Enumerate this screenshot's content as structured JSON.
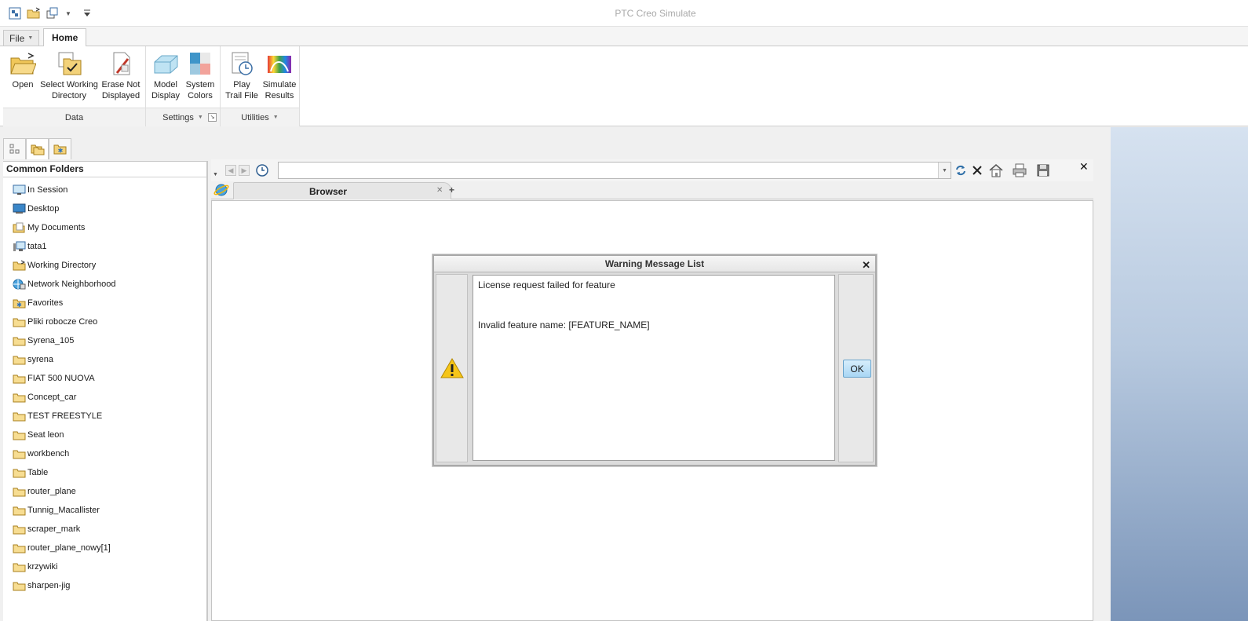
{
  "app": {
    "title": "PTC Creo Simulate",
    "quick_access": [
      "new-session-icon",
      "open-icon",
      "windows-icon",
      "customize-icon"
    ]
  },
  "ribbon": {
    "tabs": [
      {
        "label": "File",
        "active": false
      },
      {
        "label": "Home",
        "active": true
      }
    ],
    "groups": {
      "data": {
        "label": "Data",
        "buttons": [
          {
            "label": "Open",
            "icon": "open-folder-icon"
          },
          {
            "label": "Select Working Directory",
            "icon": "working-directory-icon"
          },
          {
            "label": "Erase Not Displayed",
            "icon": "erase-icon"
          }
        ]
      },
      "settings": {
        "label": "Settings",
        "buttons": [
          {
            "label": "Model Display",
            "icon": "model-display-icon"
          },
          {
            "label": "System Colors",
            "icon": "system-colors-icon"
          }
        ]
      },
      "utilities": {
        "label": "Utilities",
        "buttons": [
          {
            "label": "Play Trail File",
            "icon": "trail-file-icon"
          },
          {
            "label": "Simulate Results",
            "icon": "simulate-results-icon"
          }
        ]
      }
    },
    "labels": {
      "open_1": "Open",
      "swd_1": "Select Working",
      "swd_2": "Directory",
      "end_1": "Erase Not",
      "end_2": "Displayed",
      "md_1": "Model",
      "md_2": "Display",
      "sc_1": "System",
      "sc_2": "Colors",
      "ptf_1": "Play",
      "ptf_2": "Trail File",
      "sr_1": "Simulate",
      "sr_2": "Results"
    }
  },
  "navigator": {
    "tabs": [
      "model-tree-icon",
      "folder-browser-icon",
      "favorites-icon"
    ],
    "title": "Common Folders",
    "items": [
      {
        "label": "In Session",
        "icon": "in-session-icon"
      },
      {
        "label": "Desktop",
        "icon": "desktop-icon"
      },
      {
        "label": "My Documents",
        "icon": "documents-icon"
      },
      {
        "label": "tata1",
        "icon": "computer-icon"
      },
      {
        "label": "Working Directory",
        "icon": "working-directory-folder-icon"
      },
      {
        "label": "Network Neighborhood",
        "icon": "network-icon"
      },
      {
        "label": "Favorites",
        "icon": "favorites-folder-icon"
      },
      {
        "label": "Pliki robocze Creo",
        "icon": "folder-icon"
      },
      {
        "label": "Syrena_105",
        "icon": "folder-icon"
      },
      {
        "label": "syrena",
        "icon": "folder-icon"
      },
      {
        "label": "FIAT 500 NUOVA",
        "icon": "folder-icon"
      },
      {
        "label": "Concept_car",
        "icon": "folder-icon"
      },
      {
        "label": "TEST FREESTYLE",
        "icon": "folder-icon"
      },
      {
        "label": "Seat leon",
        "icon": "folder-icon"
      },
      {
        "label": "workbench",
        "icon": "folder-icon"
      },
      {
        "label": "Table",
        "icon": "folder-icon"
      },
      {
        "label": "router_plane",
        "icon": "folder-icon"
      },
      {
        "label": "Tunnig_Macallister",
        "icon": "folder-icon"
      },
      {
        "label": "scraper_mark",
        "icon": "folder-icon"
      },
      {
        "label": "router_plane_nowy[1]",
        "icon": "folder-icon"
      },
      {
        "label": "krzywiki",
        "icon": "folder-icon"
      },
      {
        "label": "sharpen-jig",
        "icon": "folder-icon"
      }
    ]
  },
  "browser": {
    "address_value": "",
    "tab_title": "Browser"
  },
  "dialog": {
    "title": "Warning Message List",
    "line1": "License request failed for feature",
    "line2": "",
    "line3": "",
    "line4": "Invalid feature name: [FEATURE_NAME]",
    "ok_label": "OK"
  },
  "colors": {
    "accent_blue": "#3a7fc4",
    "folder_yellow": "#f3d27a",
    "warning_yellow": "#f5c518",
    "right_gradient_bottom": "#7b95b9"
  }
}
